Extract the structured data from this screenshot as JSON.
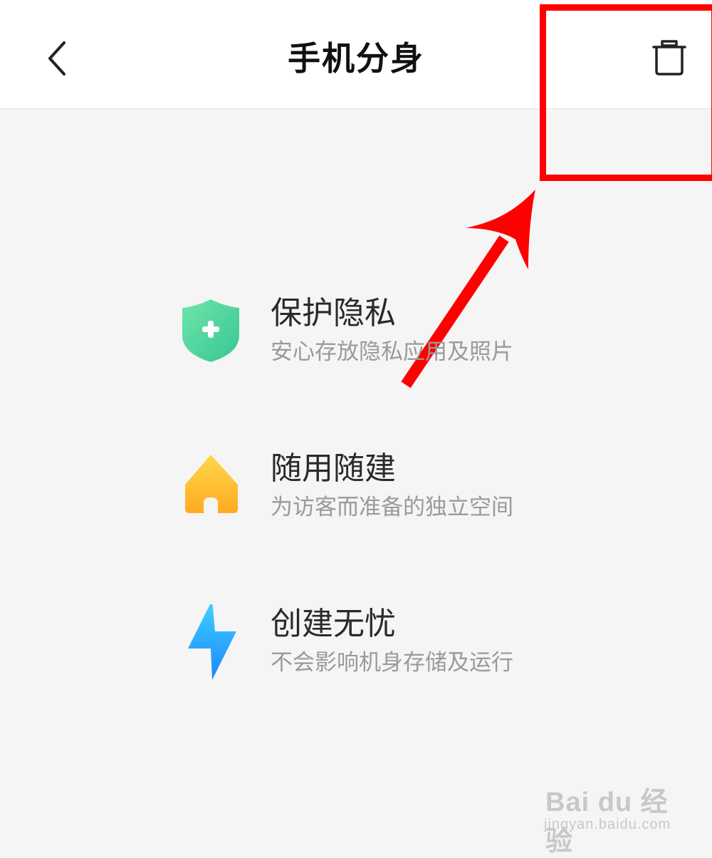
{
  "header": {
    "title": "手机分身",
    "back_icon": "chevron-left-icon",
    "trash_icon": "trash-icon"
  },
  "features": [
    {
      "title": "保护隐私",
      "description": "安心存放隐私应用及照片",
      "icon": "shield-plus-icon",
      "color": "#4fd6a0"
    },
    {
      "title": "随用随建",
      "description": "为访客而准备的独立空间",
      "icon": "home-icon",
      "color": "#ffc531"
    },
    {
      "title": "创建无忧",
      "description": "不会影响机身存储及运行",
      "icon": "lightning-icon",
      "color": "#2fa8ff"
    }
  ],
  "annotation": {
    "highlight_color": "#ff0000",
    "arrow_color": "#ff0000"
  },
  "watermark": {
    "logo": "Bai du 经验",
    "url": "jingyan.baidu.com"
  },
  "colors": {
    "background": "#f5f5f5",
    "header_background": "#ffffff",
    "title_text": "#111111",
    "description_text": "#9a9a9a"
  }
}
